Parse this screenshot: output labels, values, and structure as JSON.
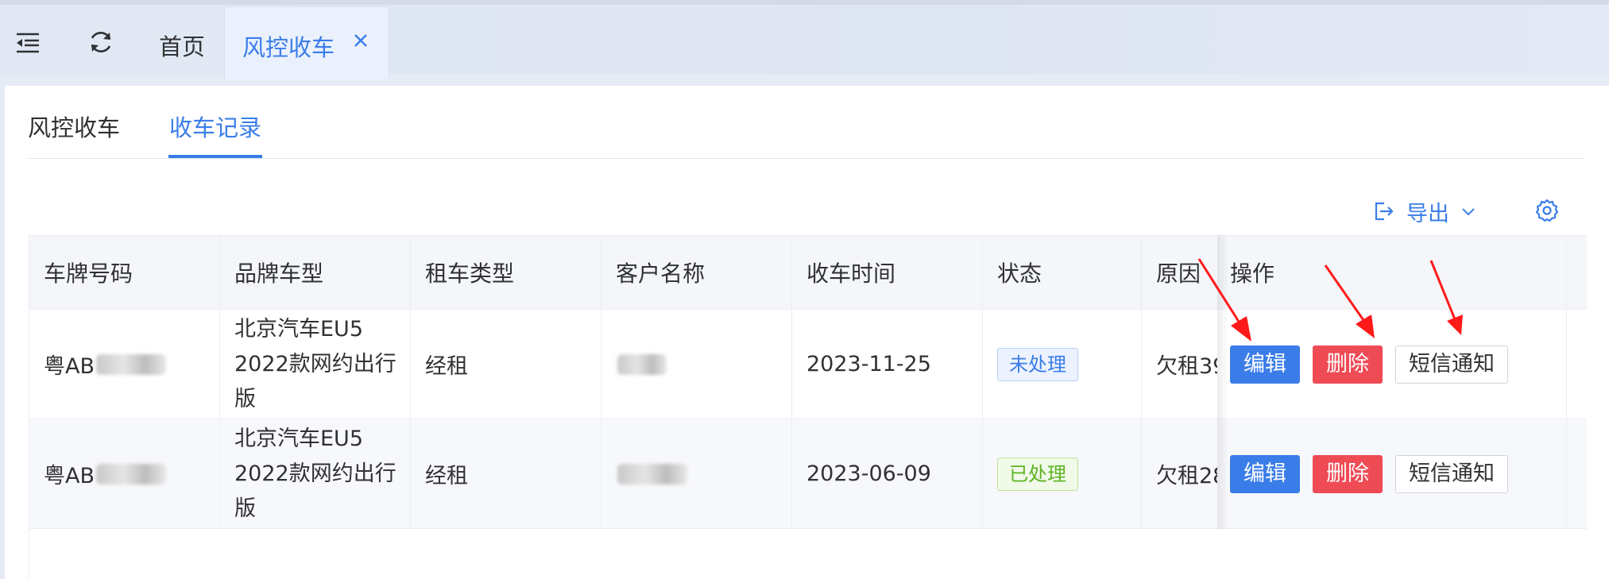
{
  "topbar": {
    "home_label": "首页",
    "active_tab_label": "风控收车",
    "close_glyph": "×"
  },
  "subtabs": [
    {
      "label": "风控收车",
      "active": false
    },
    {
      "label": "收车记录",
      "active": true
    }
  ],
  "toolbar": {
    "export_label": "导出",
    "icons": [
      "export-icon",
      "chevron-down-icon",
      "settings-icon"
    ]
  },
  "table": {
    "columns": [
      "车牌号码",
      "品牌车型",
      "租车类型",
      "客户名称",
      "收车时间",
      "状态",
      "原因",
      "操作"
    ],
    "rows": [
      {
        "plate": "粤AB",
        "model": "北京汽车EU5 2022款网约出行版",
        "rent_type": "经租",
        "customer": "",
        "date": "2023-11-25",
        "status": "未处理",
        "reason": "欠租39"
      },
      {
        "plate": "粤AB",
        "model": "北京汽车EU5 2022款网约出行版",
        "rent_type": "经租",
        "customer": "",
        "date": "2023-06-09",
        "status": "已处理",
        "reason": "欠租28"
      }
    ],
    "actions": {
      "edit": "编辑",
      "delete": "删除",
      "sms": "短信通知"
    }
  },
  "colors": {
    "accent": "#3a7de8",
    "danger": "#ef4b55",
    "success": "#5fb320",
    "annotation_arrow": "#ff1a1a"
  }
}
